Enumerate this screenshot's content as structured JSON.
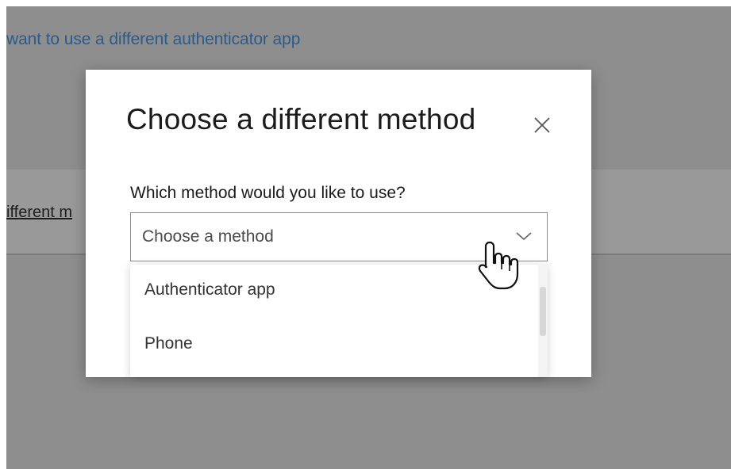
{
  "background": {
    "link_text": "want to use a different authenticator app",
    "partial_link_text": "ifferent m"
  },
  "modal": {
    "title": "Choose a different method",
    "close_icon": "close-icon",
    "question": "Which method would you like to use?",
    "select": {
      "placeholder": "Choose a method",
      "icon": "chevron-down-icon"
    },
    "options": [
      {
        "label": "Authenticator app"
      },
      {
        "label": "Phone"
      }
    ]
  },
  "cursor_icon": "hand-pointer-icon",
  "colors": {
    "overlay": "#8e8e8e",
    "link": "#2b5b8c",
    "modal_bg": "#ffffff",
    "text": "#1b1b1b"
  }
}
